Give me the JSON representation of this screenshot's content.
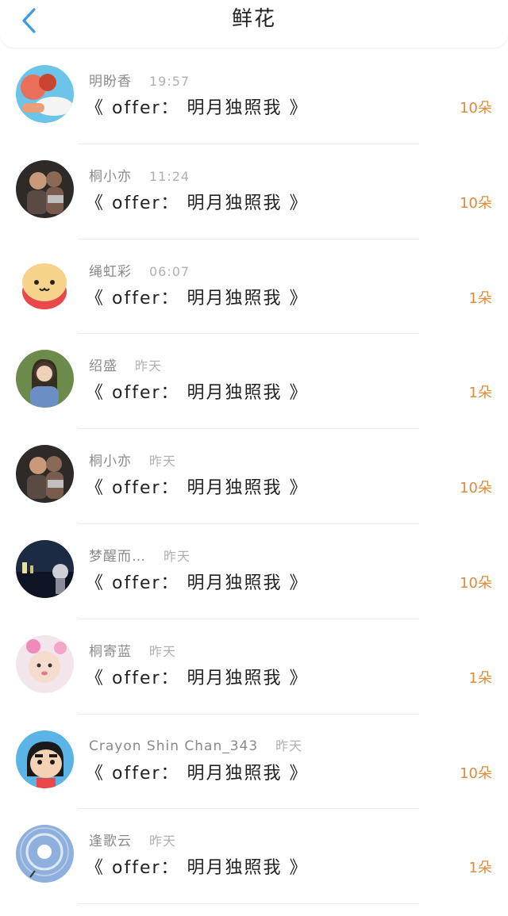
{
  "header": {
    "title": "鲜花",
    "back_icon": "chevron-left-icon",
    "accent_color": "#3a9be0"
  },
  "colors": {
    "count": "#e08a3c",
    "name": "#8a8a8a",
    "time": "#b0b0b0",
    "message": "#222222"
  },
  "items": [
    {
      "name": "明盼香",
      "time": "19:57",
      "message": "《 offer： 明月独照我 》",
      "count": "10朵",
      "avatar": "cartoon-illustration-avatar"
    },
    {
      "name": "桐小亦",
      "time": "11:24",
      "message": "《 offer： 明月独照我 》",
      "count": "10朵",
      "avatar": "couple-photo-avatar"
    },
    {
      "name": "绳虹彩",
      "time": "06:07",
      "message": "《 offer： 明月独照我 》",
      "count": "1朵",
      "avatar": "cute-cartoon-face-avatar"
    },
    {
      "name": "绍盛",
      "time": "昨天",
      "message": "《 offer： 明月独照我 》",
      "count": "1朵",
      "avatar": "girl-photo-avatar"
    },
    {
      "name": "桐小亦",
      "time": "昨天",
      "message": "《 offer： 明月独照我 》",
      "count": "10朵",
      "avatar": "couple-photo-avatar"
    },
    {
      "name": "梦醒而…",
      "time": "昨天",
      "message": "《 offer： 明月独照我 》",
      "count": "10朵",
      "avatar": "night-city-avatar"
    },
    {
      "name": "桐寄蓝",
      "time": "昨天",
      "message": "《 offer： 明月独照我 》",
      "count": "1朵",
      "avatar": "baby-photo-avatar"
    },
    {
      "name": "Crayon Shin Chan_343",
      "time": "昨天",
      "message": "《 offer： 明月独照我 》",
      "count": "10朵",
      "avatar": "crayon-shinchan-avatar"
    },
    {
      "name": "逢歌云",
      "time": "昨天",
      "message": "《 offer： 明月独照我 》",
      "count": "1朵",
      "avatar": "sky-halo-avatar"
    }
  ]
}
